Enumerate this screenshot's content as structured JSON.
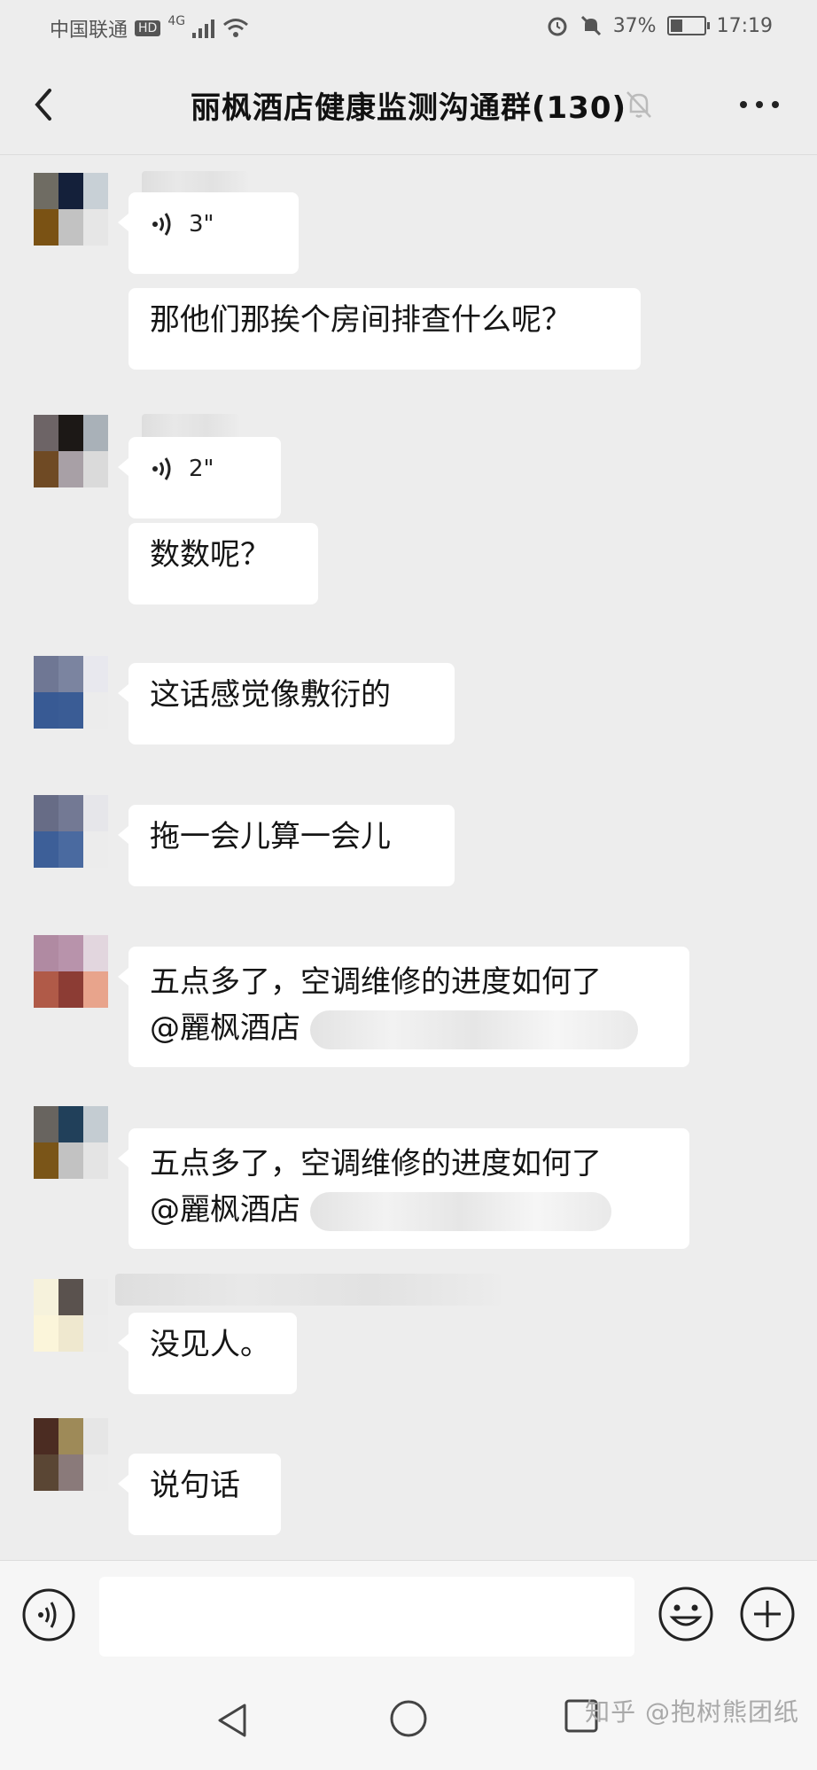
{
  "status_bar": {
    "carrier": "中国联通",
    "hd": "HD",
    "network": "4G",
    "battery": "37%",
    "battery_level": 0.37,
    "time": "17:19"
  },
  "header": {
    "title": "丽枫酒店健康监测沟通群(130)"
  },
  "messages": [
    {
      "type": "voice",
      "duration": "3\""
    },
    {
      "type": "text",
      "text": "那他们那挨个房间排查什么呢？"
    },
    {
      "type": "voice",
      "duration": "2\""
    },
    {
      "type": "text",
      "text": "数数呢？"
    },
    {
      "type": "text",
      "text": "这话感觉像敷衍的"
    },
    {
      "type": "text",
      "text": "拖一会儿算一会儿"
    },
    {
      "type": "text",
      "line1": "五点多了，空调维修的进度如何了",
      "line2": "@麗枫酒店"
    },
    {
      "type": "text",
      "line1": "五点多了，空调维修的进度如何了",
      "line2": "@麗枫酒店"
    },
    {
      "type": "text",
      "text": "没见人。"
    },
    {
      "type": "text",
      "text": "说句话"
    }
  ],
  "input": {
    "placeholder": ""
  },
  "watermark": "知乎 @抱树熊团纸",
  "icons": {
    "back": "chevron-left-icon",
    "mute": "bell-off-icon",
    "more": "more-dots-icon",
    "voice": "voice-icon",
    "emoji": "emoji-icon",
    "plus": "plus-icon",
    "nav_back": "triangle-back-icon",
    "nav_home": "circle-home-icon",
    "nav_recent": "square-recent-icon"
  }
}
